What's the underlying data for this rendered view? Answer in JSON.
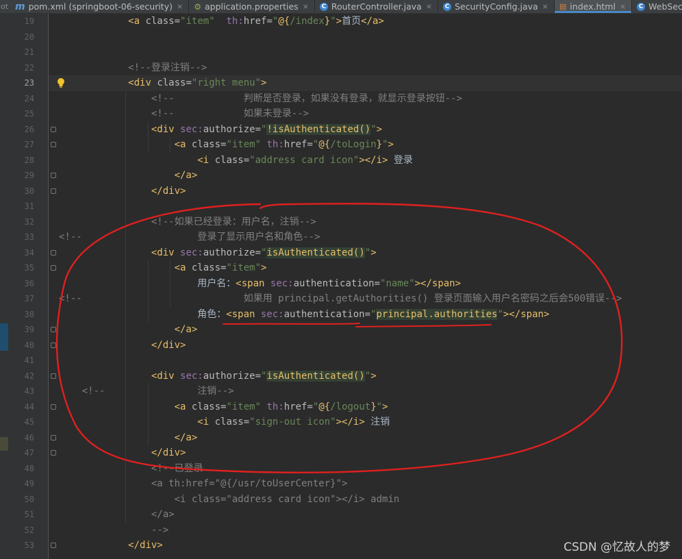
{
  "tabs": [
    {
      "icon": "maven-m-icon",
      "label": "pom.xml (springboot-06-security)",
      "close": "×",
      "active": false
    },
    {
      "icon": "properties-icon",
      "label": "application.properties",
      "close": "×",
      "active": false
    },
    {
      "icon": "class-c-icon",
      "label": "RouterController.java",
      "close": "×",
      "active": false
    },
    {
      "icon": "class-c-icon",
      "label": "SecurityConfig.java",
      "close": "×",
      "active": false
    },
    {
      "icon": "html-icon",
      "label": "index.html",
      "close": "×",
      "active": true
    },
    {
      "icon": "class-c-icon",
      "label": "WebSecurit",
      "close": "",
      "active": false
    }
  ],
  "tab_stub": "ot",
  "editor": {
    "current_line": 23,
    "lines": [
      {
        "n": 19,
        "indent": 0,
        "tokens": [
          [
            "txt",
            "            "
          ],
          [
            "tag",
            "<a "
          ],
          [
            "attr",
            "class="
          ],
          [
            "str",
            "\"item\""
          ],
          [
            "attr",
            "  "
          ],
          [
            "ns",
            "th:"
          ],
          [
            "attr",
            "href="
          ],
          [
            "str",
            "\""
          ],
          [
            "expr",
            "@{"
          ],
          [
            "str",
            "/index"
          ],
          [
            "expr",
            "}"
          ],
          [
            "str",
            "\""
          ],
          [
            "tag",
            ">"
          ],
          [
            "txt",
            "首页"
          ],
          [
            "tag",
            "</a>"
          ]
        ]
      },
      {
        "n": 20,
        "tokens": []
      },
      {
        "n": 21,
        "tokens": []
      },
      {
        "n": 22,
        "tokens": [
          [
            "txt",
            "            "
          ],
          [
            "cmt",
            "<!--登录注销-->"
          ]
        ]
      },
      {
        "n": 23,
        "tokens": [
          [
            "txt",
            "            "
          ],
          [
            "tag",
            "<div "
          ],
          [
            "attr",
            "class="
          ],
          [
            "str",
            "\"right menu\""
          ],
          [
            "tag",
            ">"
          ]
        ]
      },
      {
        "n": 24,
        "tokens": [
          [
            "txt",
            "                "
          ],
          [
            "cmt",
            "<!--            判断是否登录，如果没有登录，就显示登录按钮-->"
          ]
        ]
      },
      {
        "n": 25,
        "tokens": [
          [
            "txt",
            "                "
          ],
          [
            "cmt",
            "<!--            如果未登录-->"
          ]
        ]
      },
      {
        "n": 26,
        "tokens": [
          [
            "txt",
            "                "
          ],
          [
            "tag",
            "<div "
          ],
          [
            "ns",
            "sec:"
          ],
          [
            "attr",
            "authorize="
          ],
          [
            "str",
            "\""
          ],
          [
            "expr",
            "!isAuthenticated()"
          ],
          [
            "str",
            "\""
          ],
          [
            "tag",
            ">"
          ]
        ]
      },
      {
        "n": 27,
        "tokens": [
          [
            "txt",
            "                    "
          ],
          [
            "tag",
            "<a "
          ],
          [
            "attr",
            "class="
          ],
          [
            "str",
            "\"item\" "
          ],
          [
            "ns",
            "th:"
          ],
          [
            "attr",
            "href="
          ],
          [
            "str",
            "\""
          ],
          [
            "expr",
            "@{"
          ],
          [
            "str",
            "/toLogin"
          ],
          [
            "expr",
            "}"
          ],
          [
            "str",
            "\""
          ],
          [
            "tag",
            ">"
          ]
        ]
      },
      {
        "n": 28,
        "tokens": [
          [
            "txt",
            "                        "
          ],
          [
            "tag",
            "<i "
          ],
          [
            "attr",
            "class="
          ],
          [
            "str",
            "\"address card icon\""
          ],
          [
            "tag",
            "></i>"
          ],
          [
            "txt",
            " 登录"
          ]
        ]
      },
      {
        "n": 29,
        "tokens": [
          [
            "txt",
            "                    "
          ],
          [
            "tag",
            "</a>"
          ]
        ]
      },
      {
        "n": 30,
        "tokens": [
          [
            "txt",
            "                "
          ],
          [
            "tag",
            "</div>"
          ]
        ]
      },
      {
        "n": 31,
        "tokens": []
      },
      {
        "n": 32,
        "tokens": [
          [
            "txt",
            "                "
          ],
          [
            "cmt",
            "<!--如果已经登录：用户名，注销-->"
          ]
        ]
      },
      {
        "n": 33,
        "tokens": [
          [
            "cmt",
            "<!--"
          ],
          [
            "txt",
            "                    "
          ],
          [
            "cmt",
            "登录了显示用户名和角色-->"
          ]
        ]
      },
      {
        "n": 34,
        "tokens": [
          [
            "txt",
            "                "
          ],
          [
            "tag",
            "<div "
          ],
          [
            "ns",
            "sec:"
          ],
          [
            "attr",
            "authorize="
          ],
          [
            "str",
            "\""
          ],
          [
            "expr",
            "isAuthenticated()"
          ],
          [
            "str",
            "\""
          ],
          [
            "tag",
            ">"
          ]
        ]
      },
      {
        "n": 35,
        "tokens": [
          [
            "txt",
            "                    "
          ],
          [
            "tag",
            "<a "
          ],
          [
            "attr",
            "class="
          ],
          [
            "str",
            "\"item\""
          ],
          [
            "tag",
            ">"
          ]
        ]
      },
      {
        "n": 36,
        "tokens": [
          [
            "txt",
            "                        用户名："
          ],
          [
            "tag",
            "<span "
          ],
          [
            "ns",
            "sec:"
          ],
          [
            "attr",
            "authentication="
          ],
          [
            "str",
            "\"name\""
          ],
          [
            "tag",
            "></span>"
          ]
        ]
      },
      {
        "n": 37,
        "tokens": [
          [
            "cmt",
            "<!--"
          ],
          [
            "txt",
            "                            "
          ],
          [
            "cmt",
            "如果用 principal.getAuthorities() 登录页面输入用户名密码之后会500错误-->"
          ]
        ]
      },
      {
        "n": 38,
        "tokens": [
          [
            "txt",
            "                        角色："
          ],
          [
            "tag",
            "<span "
          ],
          [
            "ns",
            "sec:"
          ],
          [
            "attr",
            "authentication="
          ],
          [
            "str",
            "\""
          ],
          [
            "expr",
            "principal.authorities"
          ],
          [
            "str",
            "\""
          ],
          [
            "tag",
            "></span>"
          ]
        ]
      },
      {
        "n": 39,
        "tokens": [
          [
            "txt",
            "                    "
          ],
          [
            "tag",
            "</a>"
          ]
        ]
      },
      {
        "n": 40,
        "tokens": [
          [
            "txt",
            "                "
          ],
          [
            "tag",
            "</div>"
          ]
        ]
      },
      {
        "n": 41,
        "tokens": []
      },
      {
        "n": 42,
        "tokens": [
          [
            "txt",
            "                "
          ],
          [
            "tag",
            "<div "
          ],
          [
            "ns",
            "sec:"
          ],
          [
            "attr",
            "authorize="
          ],
          [
            "str",
            "\""
          ],
          [
            "expr",
            "isAuthenticated()"
          ],
          [
            "str",
            "\""
          ],
          [
            "tag",
            ">"
          ]
        ]
      },
      {
        "n": 43,
        "tokens": [
          [
            "txt",
            "    "
          ],
          [
            "cmt",
            "<!--"
          ],
          [
            "txt",
            "                "
          ],
          [
            "cmt",
            "注销-->"
          ]
        ]
      },
      {
        "n": 44,
        "tokens": [
          [
            "txt",
            "                    "
          ],
          [
            "tag",
            "<a "
          ],
          [
            "attr",
            "class="
          ],
          [
            "str",
            "\"item\" "
          ],
          [
            "ns",
            "th:"
          ],
          [
            "attr",
            "href="
          ],
          [
            "str",
            "\""
          ],
          [
            "expr",
            "@{"
          ],
          [
            "str",
            "/logout"
          ],
          [
            "expr",
            "}"
          ],
          [
            "str",
            "\""
          ],
          [
            "tag",
            ">"
          ]
        ]
      },
      {
        "n": 45,
        "tokens": [
          [
            "txt",
            "                        "
          ],
          [
            "tag",
            "<i "
          ],
          [
            "attr",
            "class="
          ],
          [
            "str",
            "\"sign-out icon\""
          ],
          [
            "tag",
            "></i>"
          ],
          [
            "txt",
            " 注销"
          ]
        ]
      },
      {
        "n": 46,
        "tokens": [
          [
            "txt",
            "                    "
          ],
          [
            "tag",
            "</a>"
          ]
        ]
      },
      {
        "n": 47,
        "tokens": [
          [
            "txt",
            "                "
          ],
          [
            "tag",
            "</div>"
          ]
        ]
      },
      {
        "n": 48,
        "tokens": [
          [
            "txt",
            "                "
          ],
          [
            "cmt",
            "<!--已登录"
          ]
        ]
      },
      {
        "n": 49,
        "tokens": [
          [
            "txt",
            "                "
          ],
          [
            "cmt",
            "<a th:href=\"@{/usr/toUserCenter}\">"
          ]
        ]
      },
      {
        "n": 50,
        "tokens": [
          [
            "txt",
            "                    "
          ],
          [
            "cmt",
            "<i class=\"address card icon\"></i> admin"
          ]
        ]
      },
      {
        "n": 51,
        "tokens": [
          [
            "txt",
            "                "
          ],
          [
            "cmt",
            "</a>"
          ]
        ]
      },
      {
        "n": 52,
        "tokens": [
          [
            "txt",
            "                "
          ],
          [
            "cmt",
            "-->"
          ]
        ]
      },
      {
        "n": 53,
        "tokens": [
          [
            "txt",
            "            "
          ],
          [
            "tag",
            "</div>"
          ]
        ]
      }
    ]
  },
  "watermark": "CSDN @忆故人的梦",
  "colors": {
    "background": "#2b2b2b",
    "gutter": "#313335",
    "tag": "#e8bf6a",
    "attribute": "#bababa",
    "namespace": "#9876aa",
    "string": "#6a8759",
    "comment": "#808080",
    "annotation": "#e0201f"
  }
}
